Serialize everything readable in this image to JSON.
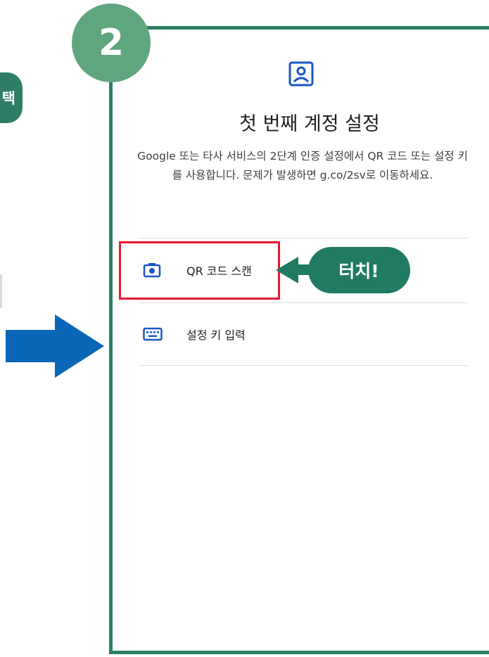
{
  "left_step_label": "택",
  "step_badge": "2",
  "dialog": {
    "title": "첫 번째 계정 설정",
    "description": "Google 또는 타사 서비스의 2단계 인증 설정에서 QR 코드 또는 설정 키를 사용합니다. 문제가 발생하면 g.co/2sv로 이동하세요."
  },
  "options": [
    {
      "label": "QR 코드 스캔",
      "icon": "camera-icon"
    },
    {
      "label": "설정 키 입력",
      "icon": "keyboard-icon"
    }
  ],
  "callout": {
    "text": "터치!"
  },
  "colors": {
    "frame": "#2e7d67",
    "badge": "#5fa67f",
    "highlight": "#e8182c",
    "icon_blue": "#1a56c4",
    "arrow_blue": "#0a67b8"
  }
}
